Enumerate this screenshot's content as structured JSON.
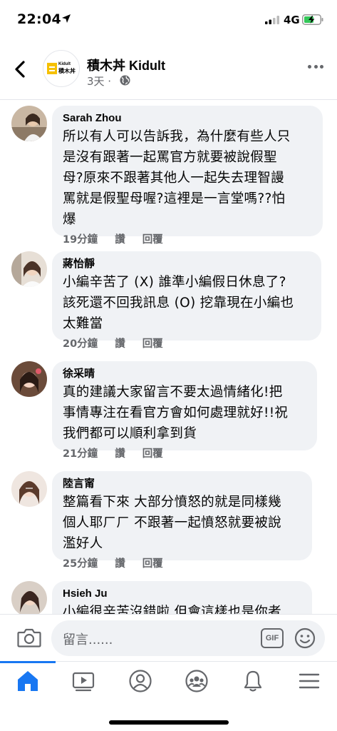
{
  "status_bar": {
    "time": "22:04",
    "network": "4G"
  },
  "header": {
    "page_name": "積木丼 Kidult",
    "post_time": "3天 ·",
    "logo_line1": "Kidult",
    "logo_line2": "積木丼"
  },
  "comments": [
    {
      "name": "Sarah Zhou",
      "lines": [
        "所以有人可以告訴我，為什麼有些人只",
        "是沒有跟著一起罵官方就要被說假聖",
        "母?原來不跟著其他人一起失去理智謾",
        "罵就是假聖母喔?這裡是一言堂嗎??怕",
        "爆"
      ],
      "time": "19分鐘",
      "like": "讚",
      "reply": "回覆"
    },
    {
      "name": "蔣怡靜",
      "lines": [
        "小編辛苦了 (X) 誰準小編假日休息了?",
        "該死還不回我訊息 (O) 挖靠現在小編也",
        "太難當"
      ],
      "time": "20分鐘",
      "like": "讚",
      "reply": "回覆"
    },
    {
      "name": "徐采晴",
      "lines": [
        "真的建議大家留言不要太過情緒化!把",
        "事情專注在看官方會如何處理就好!!祝",
        "我們都可以順利拿到貨"
      ],
      "time": "21分鐘",
      "like": "讚",
      "reply": "回覆"
    },
    {
      "name": "陸言甯",
      "lines": [
        "整篇看下來 大部分憤怒的就是同樣幾",
        "個人耶ㄏㄏ 不跟著一起憤怒就要被說",
        "濫好人"
      ],
      "time": "25分鐘",
      "like": "讚",
      "reply": "回覆"
    },
    {
      "name": "Hsieh Ju",
      "lines": [
        "小編很辛苦沒錯啦 但會這樣也是你者"
      ]
    }
  ],
  "composer": {
    "placeholder": "留言......",
    "gif_label": "GIF"
  },
  "colors": {
    "accent": "#1877f2",
    "bubble": "#f0f2f5",
    "secondary_text": "#65676b"
  },
  "tabs": [
    "home-icon",
    "watch-icon",
    "profile-icon",
    "groups-icon",
    "notifications-icon",
    "menu-icon"
  ]
}
